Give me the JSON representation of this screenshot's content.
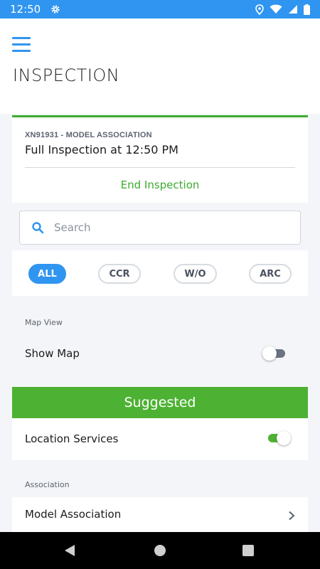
{
  "status_bar": {
    "time": "12:50"
  },
  "header": {
    "title": "INSPECTION"
  },
  "inspection": {
    "subtitle": "XN91931 - MODEL ASSOCIATION",
    "title": "Full Inspection at 12:50 PM",
    "end_label": "End Inspection"
  },
  "search": {
    "placeholder": "Search"
  },
  "filters": [
    {
      "label": "ALL",
      "active": true
    },
    {
      "label": "CCR",
      "active": false
    },
    {
      "label": "W/O",
      "active": false
    },
    {
      "label": "ARC",
      "active": false
    }
  ],
  "map_view": {
    "section_label": "Map View",
    "show_map_label": "Show Map",
    "show_map_on": false
  },
  "suggested": {
    "label": "Suggested"
  },
  "location_services": {
    "label": "Location Services",
    "on": true
  },
  "association": {
    "section_label": "Association",
    "model_label": "Model Association"
  },
  "colors": {
    "primary": "#2f95f0",
    "success": "#3cab2f",
    "suggested_bg": "#4db233"
  }
}
